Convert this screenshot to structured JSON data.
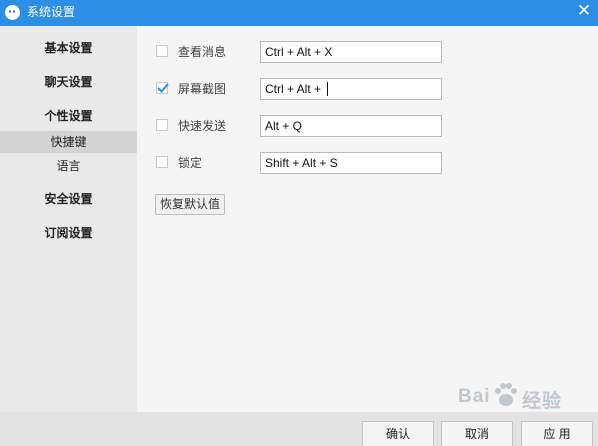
{
  "window": {
    "title": "系统设置",
    "close_symbol": "✕",
    "icons": {
      "app": "qq-penguin-icon",
      "close": "close-icon"
    }
  },
  "sidebar": {
    "items": [
      {
        "label": "基本设置"
      },
      {
        "label": "聊天设置"
      },
      {
        "label": "个性设置"
      },
      {
        "label": "快捷键",
        "sub": true,
        "active": true
      },
      {
        "label": "语言",
        "sub": true
      },
      {
        "label": "安全设置"
      },
      {
        "label": "订阅设置"
      }
    ]
  },
  "hotkeys": [
    {
      "label": "查看消息",
      "checked": false,
      "value": "Ctrl + Alt + X"
    },
    {
      "label": "屏幕截图",
      "checked": true,
      "value": "Ctrl + Alt + "
    },
    {
      "label": "快速发送",
      "checked": false,
      "value": "Alt + Q"
    },
    {
      "label": "锁定",
      "checked": false,
      "value": "Shift + Alt + S"
    }
  ],
  "restore_defaults_label": "恢复默认值",
  "footer": {
    "confirm_label": "确认",
    "cancel_label": "取消",
    "apply_label": "应 用"
  },
  "watermark": {
    "text_left": "Bai",
    "text_right": "经验",
    "icon": "baidu-paw-icon"
  },
  "colors": {
    "titlebar": "#2d8ee6",
    "checkmark": "#2d8ee6",
    "sidebar_bg": "#e9e9e9",
    "sidebar_active": "#d3d3d3"
  }
}
